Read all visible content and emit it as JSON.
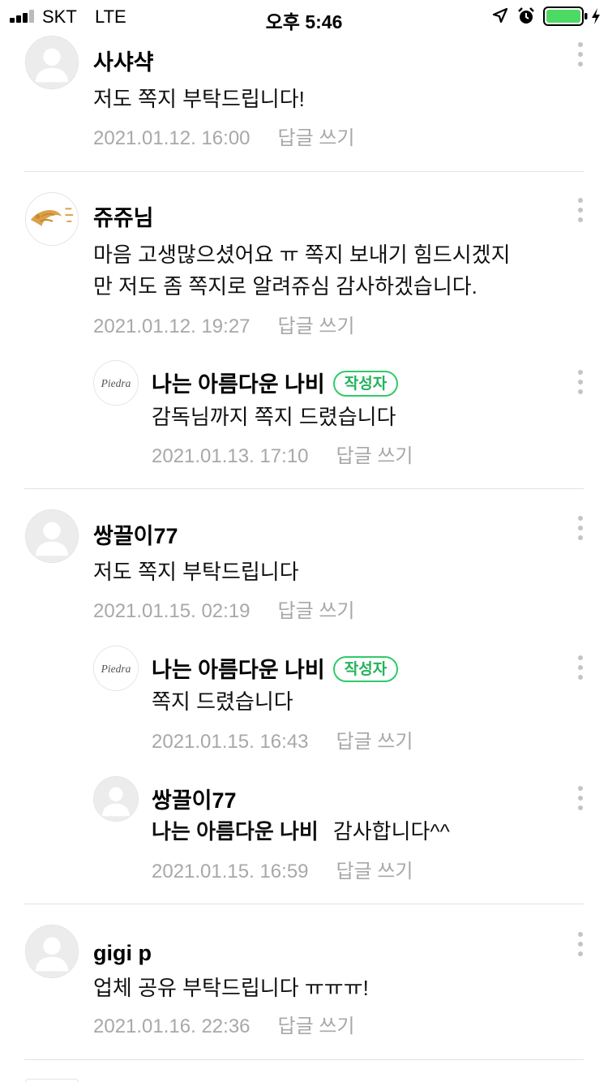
{
  "status_bar": {
    "carrier": "SKT",
    "network": "LTE",
    "time": "오후 5:46",
    "icons": [
      "signal-icon",
      "location-arrow-icon",
      "alarm-icon",
      "battery-icon",
      "charging-bolt-icon"
    ],
    "battery_color": "#4cd964"
  },
  "reply_label": "답글 쓰기",
  "author_badge": "작성자",
  "comments": [
    {
      "name": "사샤샥",
      "lines": [
        "저도 쪽지 부탁드립니다!"
      ],
      "date": "2021.01.12. 16:00"
    },
    {
      "name": "쥬쥬님",
      "lines": [
        "마음 고생많으셨어요 ㅠ 쪽지 보내기 힘드시겠지",
        "만 저도 좀 쪽지로 알려쥬심 감사하겠습니다."
      ],
      "date": "2021.01.12. 19:27"
    },
    {
      "name": "나는 아름다운 나비",
      "lines": [
        "감독님까지 쪽지 드렸습니다"
      ],
      "date": "2021.01.13. 17:10"
    },
    {
      "name": "쌍끌이77",
      "lines": [
        "저도 쪽지 부탁드립니다"
      ],
      "date": "2021.01.15. 02:19"
    },
    {
      "name": "나는 아름다운 나비",
      "lines": [
        "쪽지 드렸습니다"
      ],
      "date": "2021.01.15. 16:43"
    },
    {
      "name": "쌍끌이77",
      "mention": "나는 아름다운 나비",
      "lines": [
        "감사합니다^^"
      ],
      "date": "2021.01.15. 16:59"
    },
    {
      "name": "gigi p",
      "lines": [
        "업체 공유 부탁드립니다 ㅠㅠㅠ!"
      ],
      "date": "2021.01.16. 22:36"
    }
  ],
  "accent_color": "#2fcb6a",
  "logo_text": "Piedra"
}
